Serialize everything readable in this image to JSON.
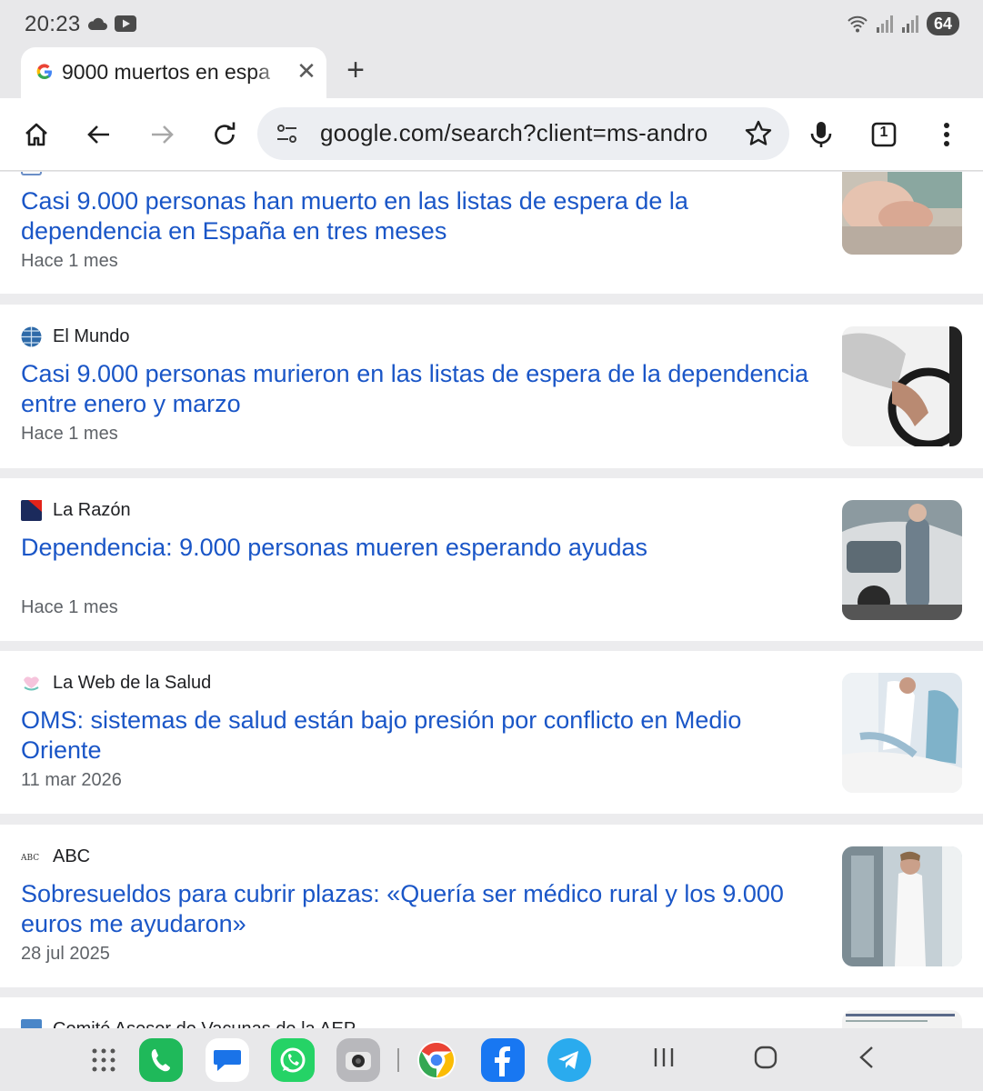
{
  "status_bar": {
    "time": "20:23",
    "battery": "64",
    "icons_left": [
      "cloud-icon",
      "youtube-icon"
    ],
    "icons_right": [
      "wifi-icon",
      "signal-icon",
      "signal-icon"
    ]
  },
  "tab": {
    "title": "9000 muertos en espa",
    "close_glyph": "✕",
    "new_tab_glyph": "+"
  },
  "toolbar": {
    "url": "google.com/search?client=ms-andro",
    "tab_count": "1"
  },
  "results": [
    {
      "source": "",
      "title": "Casi 9.000 personas han muerto en las listas de espera de la dependencia en España en tres meses",
      "date": "Hace 1 mes"
    },
    {
      "source": "El Mundo",
      "title": "Casi 9.000 personas murieron en las listas de espera de la dependencia entre enero y marzo",
      "date": "Hace 1 mes"
    },
    {
      "source": "La Razón",
      "title": "Dependencia: 9.000 personas mueren esperando ayudas",
      "date": "Hace 1 mes"
    },
    {
      "source": "La Web de la Salud",
      "title": "OMS: sistemas de salud están bajo presión por conflicto en Medio Oriente",
      "date": "11 mar 2026"
    },
    {
      "source": "ABC",
      "title": "Sobresueldos para cubrir plazas: «Quería ser médico rural y los 9.000 euros me ayudaron»",
      "date": "28 jul 2025"
    },
    {
      "source": "Comité Asesor de Vacunas de la AEP",
      "title": "",
      "date": ""
    }
  ],
  "dock": [
    "apps-grid-icon",
    "phone-icon",
    "messages-icon",
    "whatsapp-icon",
    "camera-icon",
    "chrome-icon",
    "facebook-icon",
    "telegram-icon"
  ],
  "colors": {
    "link": "#1a56c7",
    "chrome_bg": "#e8e8ea",
    "separator": "#ececee"
  }
}
